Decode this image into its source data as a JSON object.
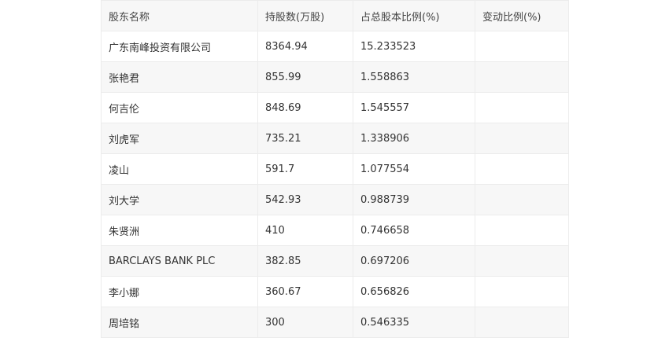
{
  "table": {
    "headers": [
      "股东名称",
      "持股数(万股)",
      "占总股本比例(%)",
      "变动比例(%)"
    ],
    "rows": [
      [
        "广东南峰投资有限公司",
        "8364.94",
        "15.233523",
        ""
      ],
      [
        "张艳君",
        "855.99",
        "1.558863",
        ""
      ],
      [
        "何吉伦",
        "848.69",
        "1.545557",
        ""
      ],
      [
        "刘虎军",
        "735.21",
        "1.338906",
        ""
      ],
      [
        "凌山",
        "591.7",
        "1.077554",
        ""
      ],
      [
        "刘大学",
        "542.93",
        "0.988739",
        ""
      ],
      [
        "朱贤洲",
        "410",
        "0.746658",
        ""
      ],
      [
        "BARCLAYS BANK PLC",
        "382.85",
        "0.697206",
        ""
      ],
      [
        "李小娜",
        "360.67",
        "0.656826",
        ""
      ],
      [
        "周培铭",
        "300",
        "0.546335",
        ""
      ]
    ]
  }
}
